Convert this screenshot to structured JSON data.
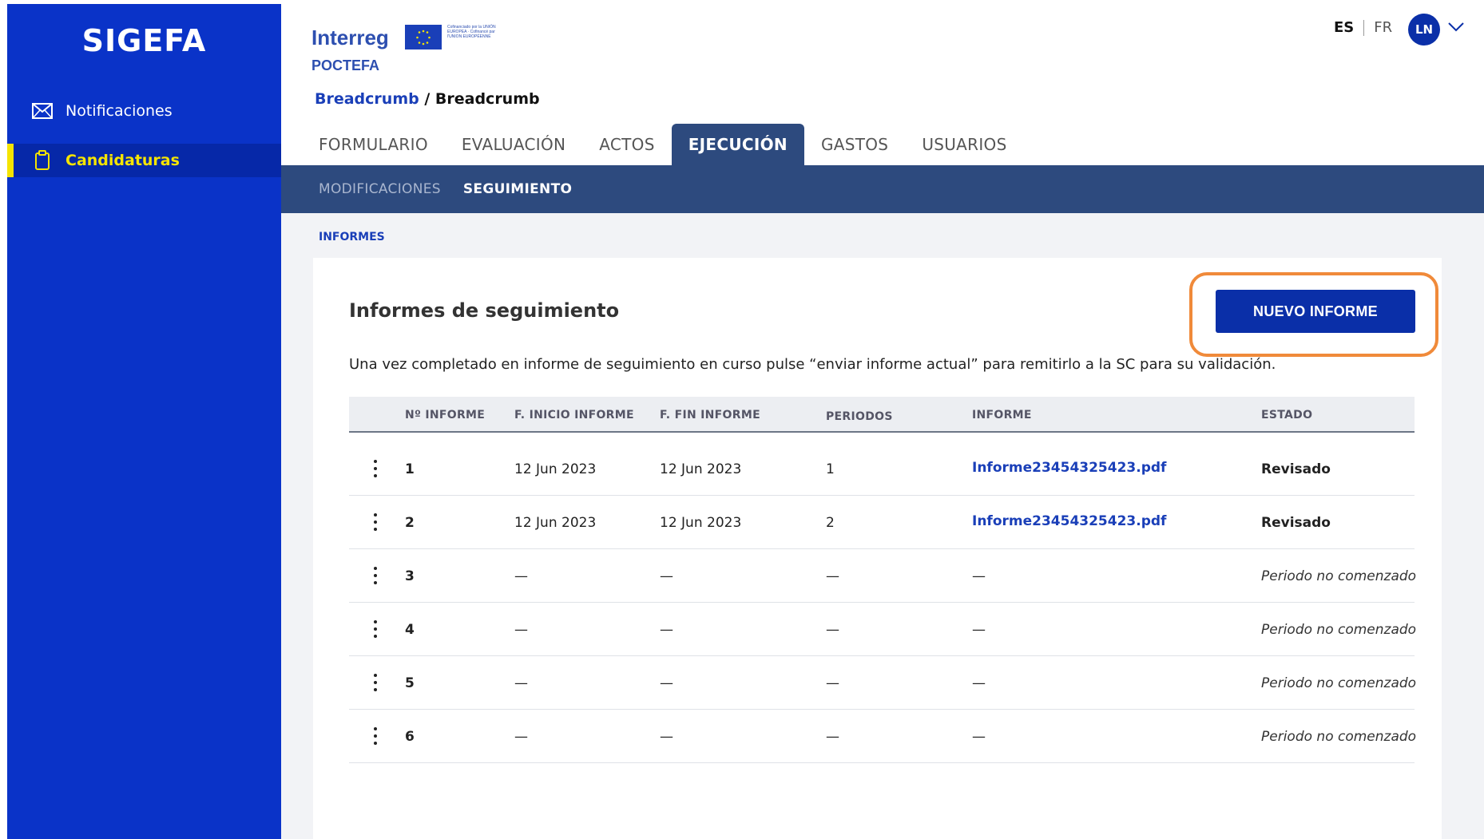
{
  "sidebar": {
    "brand": "SIGEFA",
    "items": [
      {
        "label": "Notificaciones",
        "icon": "envelope-icon",
        "active": false
      },
      {
        "label": "Candidaturas",
        "icon": "clipboard-icon",
        "active": true
      }
    ]
  },
  "header": {
    "logo_interreg": "Interreg",
    "logo_poctefa": "POCTEFA",
    "logo_cofin": "Cofinanciado por la UNIÓN EUROPEA · Cofinancé par l'UNION EUROPÉENNE",
    "lang_es": "ES",
    "lang_fr": "FR",
    "avatar_initials": "LN"
  },
  "breadcrumb": {
    "link": "Breadcrumb",
    "separator": " / ",
    "current": "Breadcrumb"
  },
  "tabs": [
    "FORMULARIO",
    "EVALUACIÓN",
    "ACTOS",
    "EJECUCIÓN",
    "GASTOS",
    "USUARIOS"
  ],
  "active_tab": "EJECUCIÓN",
  "subtabs": [
    "MODIFICACIONES",
    "SEGUIMIENTO"
  ],
  "active_subtab": "SEGUIMIENTO",
  "section_label": "INFORMES",
  "card": {
    "title": "Informes de seguimiento",
    "new_button": "NUEVO INFORME",
    "description": "Una vez completado en informe de seguimiento en curso pulse “enviar informe actual” para remitirlo a la SC para su validación."
  },
  "table": {
    "headers": [
      "Nº INFORME",
      "F. INICIO INFORME",
      "F. FIN INFORME",
      "PERIODOS",
      "INFORME",
      "ESTADO"
    ],
    "rows": [
      {
        "num": "1",
        "start": "12 Jun 2023",
        "end": "12 Jun 2023",
        "periods": "1",
        "file": "Informe23454325423.pdf",
        "status": "Revisado",
        "status_type": "bold"
      },
      {
        "num": "2",
        "start": "12 Jun 2023",
        "end": "12 Jun 2023",
        "periods": "2",
        "file": "Informe23454325423.pdf",
        "status": "Revisado",
        "status_type": "bold"
      },
      {
        "num": "3",
        "start": "—",
        "end": "—",
        "periods": "—",
        "file": "—",
        "status": "Periodo no comenzado",
        "status_type": "italic"
      },
      {
        "num": "4",
        "start": "—",
        "end": "—",
        "periods": "—",
        "file": "—",
        "status": "Periodo no comenzado",
        "status_type": "italic"
      },
      {
        "num": "5",
        "start": "—",
        "end": "—",
        "periods": "—",
        "file": "—",
        "status": "Periodo no comenzado",
        "status_type": "italic"
      },
      {
        "num": "6",
        "start": "—",
        "end": "—",
        "periods": "—",
        "file": "—",
        "status": "Periodo no comenzado",
        "status_type": "italic"
      }
    ]
  },
  "colors": {
    "sidebar": "#0a33c8",
    "active_yellow": "#f5e400",
    "nav_dark": "#2d4a7e",
    "primary": "#0a2fa8",
    "highlight": "#f08a3a"
  }
}
